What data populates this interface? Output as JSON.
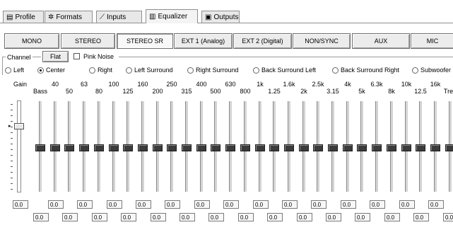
{
  "tabs": [
    {
      "label": "Profile",
      "icon": "profile-icon",
      "glyph": "▤"
    },
    {
      "label": "Formats",
      "icon": "formats-icon",
      "glyph": "✲"
    },
    {
      "label": "Inputs",
      "icon": "inputs-icon",
      "glyph": "⟋"
    },
    {
      "label": "Equalizer",
      "icon": "equalizer-icon",
      "glyph": "▥"
    },
    {
      "label": "Outputs",
      "icon": "outputs-icon",
      "glyph": "▣"
    }
  ],
  "modes": [
    "MONO",
    "STEREO",
    "STEREO SR",
    "EXT 1 (Analog)",
    "EXT 2 (Digital)",
    "NON/SYNC",
    "AUX",
    "MIC"
  ],
  "channel": {
    "group_label": "Channel",
    "flat_label": "Flat",
    "pink_noise_label": "Pink Noise",
    "options": [
      "Left",
      "Center",
      "Right",
      "Left Surround",
      "Right Surround",
      "Back Surround Left",
      "Back Surround Right",
      "Subwoofer"
    ],
    "selected": "Center"
  },
  "gain": {
    "label": "Gain",
    "value": "0.0"
  },
  "bands": [
    {
      "label": "Bass",
      "value": "0.0"
    },
    {
      "label": "40",
      "value": "0.0"
    },
    {
      "label": "50",
      "value": "0.0"
    },
    {
      "label": "63",
      "value": "0.0"
    },
    {
      "label": "80",
      "value": "0.0"
    },
    {
      "label": "100",
      "value": "0.0"
    },
    {
      "label": "125",
      "value": "0.0"
    },
    {
      "label": "160",
      "value": "0.0"
    },
    {
      "label": "200",
      "value": "0.0"
    },
    {
      "label": "250",
      "value": "0.0"
    },
    {
      "label": "315",
      "value": "0.0"
    },
    {
      "label": "400",
      "value": "0.0"
    },
    {
      "label": "500",
      "value": "0.0"
    },
    {
      "label": "630",
      "value": "0.0"
    },
    {
      "label": "800",
      "value": "0.0"
    },
    {
      "label": "1k",
      "value": "0.0"
    },
    {
      "label": "1.25",
      "value": "0.0"
    },
    {
      "label": "1.6k",
      "value": "0.0"
    },
    {
      "label": "2k",
      "value": "0.0"
    },
    {
      "label": "2.5k",
      "value": "0.0"
    },
    {
      "label": "3.15",
      "value": "0.0"
    },
    {
      "label": "4k",
      "value": "0.0"
    },
    {
      "label": "5k",
      "value": "0.0"
    },
    {
      "label": "6.3k",
      "value": "0.0"
    },
    {
      "label": "8k",
      "value": "0.0"
    },
    {
      "label": "10k",
      "value": "0.0"
    },
    {
      "label": "12.5",
      "value": "0.0"
    },
    {
      "label": "16k",
      "value": "0.0"
    },
    {
      "label": "Treb",
      "value": "0.0"
    }
  ],
  "colors": {
    "slider_thumb": "#3b3b3b",
    "accent_border": "#8f8f8f"
  }
}
